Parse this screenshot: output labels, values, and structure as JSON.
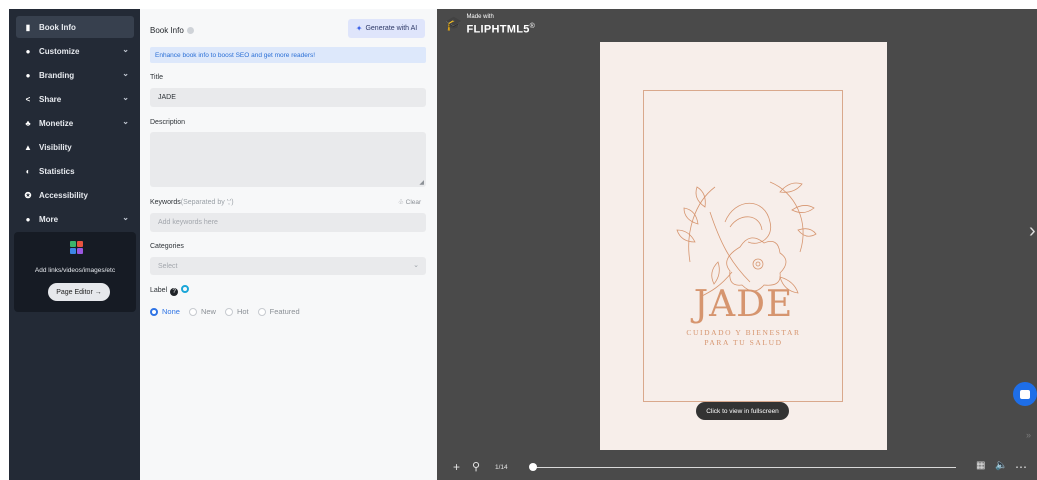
{
  "sidebar": {
    "items": [
      {
        "label": "Book Info",
        "icon": "book-icon",
        "glyph": "▮",
        "chevron": false,
        "active": true
      },
      {
        "label": "Customize",
        "icon": "palette-icon",
        "glyph": "●",
        "chevron": true,
        "active": false
      },
      {
        "label": "Branding",
        "icon": "branding-icon",
        "glyph": "●",
        "chevron": true,
        "active": false
      },
      {
        "label": "Share",
        "icon": "share-icon",
        "glyph": "<",
        "chevron": true,
        "active": false
      },
      {
        "label": "Monetize",
        "icon": "monetize-icon",
        "glyph": "♣",
        "chevron": true,
        "active": false
      },
      {
        "label": "Visibility",
        "icon": "lock-icon",
        "glyph": "▲",
        "chevron": false,
        "active": false
      },
      {
        "label": "Statistics",
        "icon": "statistics-icon",
        "glyph": "◐",
        "chevron": false,
        "active": false
      },
      {
        "label": "Accessibility",
        "icon": "accessibility-icon",
        "glyph": "✪",
        "chevron": false,
        "active": false
      },
      {
        "label": "More",
        "icon": "more-icon",
        "glyph": "●",
        "chevron": true,
        "active": false
      }
    ],
    "promo": {
      "text": "Add links/videos/images/etc",
      "button": "Page Editor",
      "button_arrow": "→"
    }
  },
  "form": {
    "title": "Book Info",
    "generate_button": "Generate with AI",
    "info_banner": "Enhance book info to boost SEO and get more readers!",
    "title_label": "Title",
    "title_value": "JADE",
    "description_label": "Description",
    "description_value": "",
    "keywords_label": "Keywords",
    "keywords_hint": "(Separated by ';')",
    "keywords_clear": "Clear",
    "keywords_placeholder": "Add keywords here",
    "categories_label": "Categories",
    "categories_placeholder": "Select",
    "label_label": "Label",
    "label_options": [
      {
        "label": "None",
        "selected": true
      },
      {
        "label": "New",
        "selected": false
      },
      {
        "label": "Hot",
        "selected": false
      },
      {
        "label": "Featured",
        "selected": false
      }
    ]
  },
  "viewer": {
    "brand_top": "Made with",
    "brand_name": "FLIPHTML5",
    "brand_mark": "®",
    "cover_title": "JADE",
    "cover_subtitle_1": "CUIDADO Y BIENESTAR",
    "cover_subtitle_2": "PARA TU SALUD",
    "fullscreen_hint": "Click to view in fullscreen",
    "page_indicator": "1/14",
    "progress": 0.0
  },
  "colors": {
    "sidebar_bg": "#232a36",
    "accent_blue": "#2f74e5",
    "viewer_bg": "#4a4a4a",
    "cover_accent": "#d6956f"
  }
}
